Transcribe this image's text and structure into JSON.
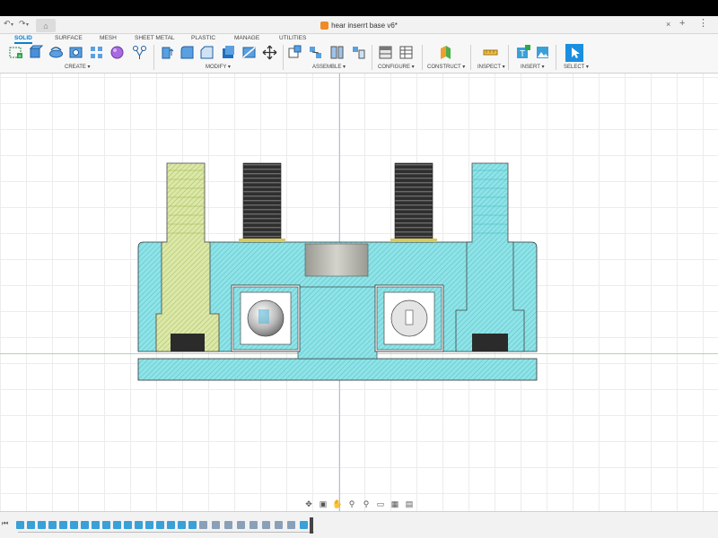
{
  "window": {
    "document_title": "hear inserrt base v6*",
    "close_glyph": "×",
    "plus_glyph": "+",
    "more_glyph": "⋮"
  },
  "ribbon": {
    "tabs": [
      {
        "label": "SOLID",
        "active": true
      },
      {
        "label": "SURFACE",
        "active": false
      },
      {
        "label": "MESH",
        "active": false
      },
      {
        "label": "SHEET METAL",
        "active": false
      },
      {
        "label": "PLASTIC",
        "active": false
      },
      {
        "label": "MANAGE",
        "active": false
      },
      {
        "label": "UTILITIES",
        "active": false
      }
    ],
    "groups": {
      "create": "CREATE ▾",
      "modify": "MODIFY ▾",
      "assemble": "ASSEMBLE ▾",
      "configure": "CONFIGURE ▾",
      "construct": "CONSTRUCT ▾",
      "inspect": "INSPECT ▾",
      "insert": "INSERT ▾",
      "select": "SELECT ▾"
    }
  },
  "colors": {
    "accent": "#0a7fcf",
    "part_cyan": "#8fe3e6",
    "part_yellow": "#d8e6a0",
    "hatch": "#2aa6b8",
    "screw_dark": "#2b2b2b",
    "insert_gray": "#b8b8b0"
  },
  "icons": {
    "undo": "undo-icon",
    "redo": "redo-icon",
    "home": "home-icon",
    "document": "document-icon"
  }
}
